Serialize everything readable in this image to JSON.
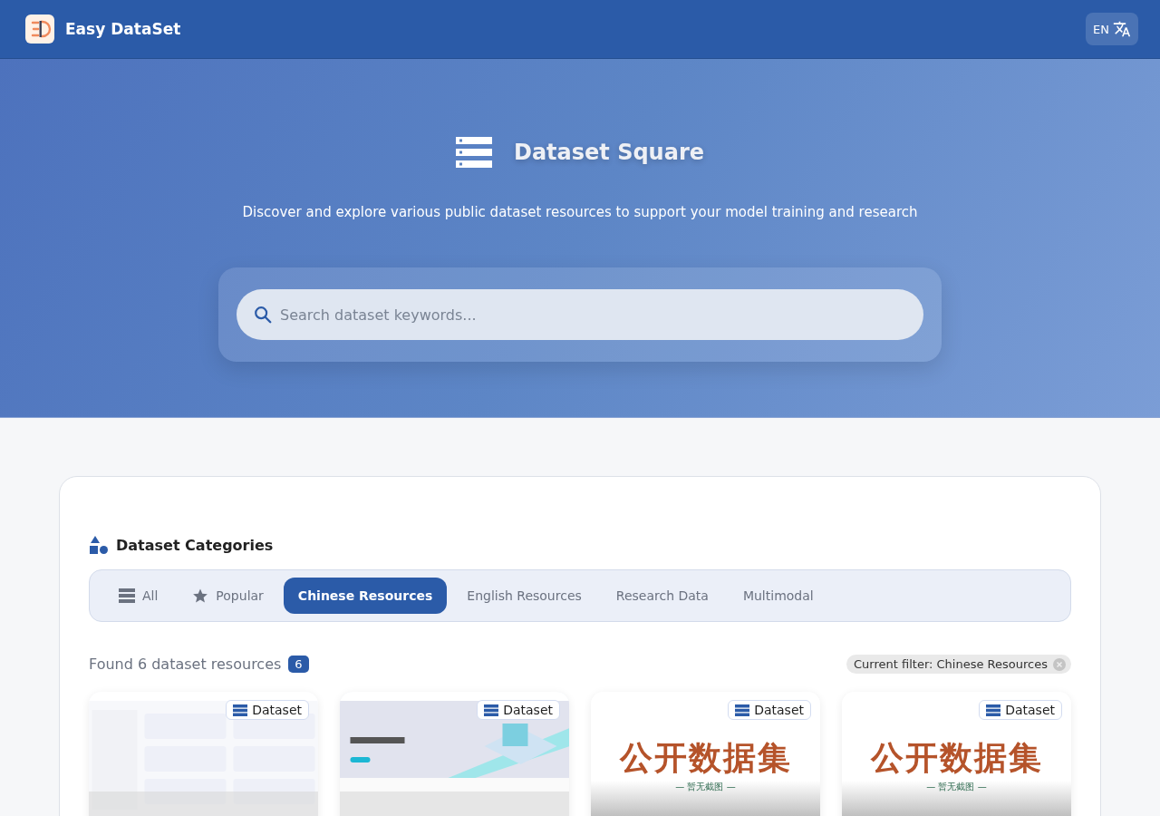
{
  "header": {
    "brand": "Easy DataSet",
    "language": "EN"
  },
  "hero": {
    "title": "Dataset Square",
    "subtitle": "Discover and explore various public dataset resources to support your model training and research",
    "search": {
      "placeholder": "Search dataset keywords..."
    }
  },
  "categories": {
    "title": "Dataset Categories",
    "tabs": [
      {
        "label": "All",
        "kind": "list",
        "selected": false
      },
      {
        "label": "Popular",
        "kind": "star",
        "selected": false
      },
      {
        "label": "Chinese Resources",
        "kind": "plain",
        "selected": true
      },
      {
        "label": "English Resources",
        "kind": "plain",
        "selected": false
      },
      {
        "label": "Research Data",
        "kind": "plain",
        "selected": false
      },
      {
        "label": "Multimodal",
        "kind": "plain",
        "selected": false
      }
    ]
  },
  "results": {
    "summary": "Found 6 dataset resources",
    "count": "6",
    "filter": "Current filter: Chinese Resources"
  },
  "cards": [
    {
      "kind": "picture",
      "badge": "Dataset"
    },
    {
      "kind": "picture",
      "badge": "Dataset"
    },
    {
      "kind": "placeholder",
      "badge": "Dataset",
      "title": "公开数据集",
      "note": "— 暂无截图 —"
    },
    {
      "kind": "placeholder",
      "badge": "Dataset",
      "title": "公开数据集",
      "note": "— 暂无截图 —"
    }
  ]
}
